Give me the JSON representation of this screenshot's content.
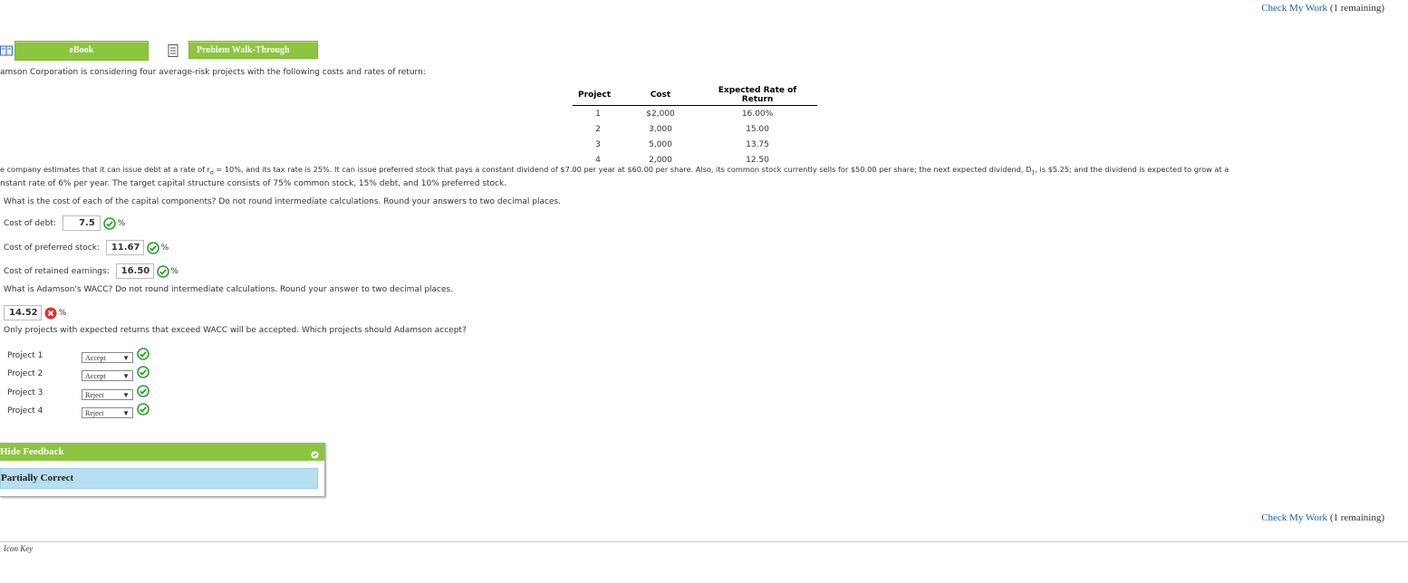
{
  "header": {
    "check_link": "Check My Work",
    "remaining": "(1 remaining)"
  },
  "buttons": {
    "ebook": "eBook",
    "walkthrough": "Problem Walk-Through"
  },
  "intro": "amson Corporation is considering four average-risk projects with the following costs and rates of return:",
  "table": {
    "headers": [
      "Project",
      "Cost",
      "Expected Rate of Return"
    ],
    "rows": [
      [
        "1",
        "$2,000",
        "16.00%"
      ],
      [
        "2",
        "3,000",
        "15.00"
      ],
      [
        "3",
        "5,000",
        "13.75"
      ],
      [
        "4",
        "2,000",
        "12.50"
      ]
    ]
  },
  "para1": "e company estimates that it can issue debt at a rate of r",
  "para1_sub": "d",
  "para1_rest": " = 10%, and its tax rate is 25%. It can issue preferred stock that pays a constant dividend of $7.00 per year at $60.00 per share. Also, its common stock currently sells for $50.00 per share; the next expected dividend, D",
  "para1_sub2": "1",
  "para1_end": ", is $5.25; and the dividend is expected to grow at a",
  "para2": "nstant rate of 6% per year. The target capital structure consists of 75% common stock, 15% debt, and 10% preferred stock.",
  "q1": "What is the cost of each of the capital components? Do not round intermediate calculations. Round your answers to two decimal places.",
  "components": {
    "debt_label": "Cost of debt:",
    "debt_value": "7.5",
    "pref_label": "Cost of preferred stock:",
    "pref_value": "11.67",
    "re_label": "Cost of retained earnings:",
    "re_value": "16.50",
    "pct": "%"
  },
  "q2": "What is Adamson's WACC? Do not round intermediate calculations. Round your answer to two decimal places.",
  "wacc_value": "14.52",
  "q3": "Only projects with expected returns that exceed WACC will be accepted. Which projects should Adamson accept?",
  "projects": [
    {
      "label": "Project 1",
      "choice": "Accept"
    },
    {
      "label": "Project 2",
      "choice": "Accept"
    },
    {
      "label": "Project 3",
      "choice": "Reject"
    },
    {
      "label": "Project 4",
      "choice": "Reject"
    }
  ],
  "feedback": {
    "toggle": "Hide Feedback",
    "status": "Partially Correct"
  },
  "footer": {
    "icon_key": "Icon Key"
  },
  "colors": {
    "accent_green": "#8cc63f",
    "link_blue": "#2456a8",
    "feedback_blue": "#b7dff0",
    "correct": "#2e9e2e",
    "wrong": "#d9322a"
  }
}
